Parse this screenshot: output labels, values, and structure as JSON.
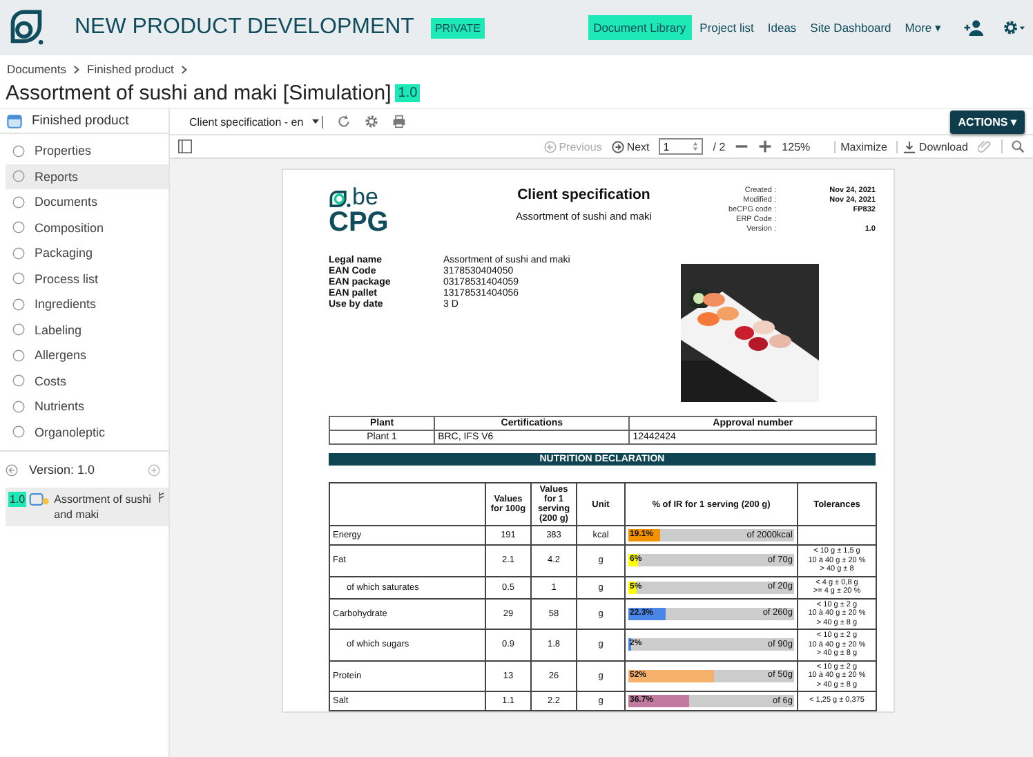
{
  "header": {
    "title": "NEW PRODUCT DEVELOPMENT",
    "badge": "PRIVATE",
    "nav": [
      {
        "label": "Document Library",
        "selected": true
      },
      {
        "label": "Project list",
        "selected": false
      },
      {
        "label": "Ideas",
        "selected": false
      },
      {
        "label": "Site Dashboard",
        "selected": false
      },
      {
        "label": "More ▾",
        "selected": false
      }
    ]
  },
  "breadcrumb": [
    "Documents",
    "Finished product"
  ],
  "page_title": "Assortment of sushi and maki [Simulation]",
  "version_badge": "1.0",
  "sidebar": {
    "header": "Finished product",
    "items": [
      {
        "label": "Properties",
        "selected": false
      },
      {
        "label": "Reports",
        "selected": true
      },
      {
        "label": "Documents",
        "selected": false
      },
      {
        "label": "Composition",
        "selected": false
      },
      {
        "label": "Packaging",
        "selected": false
      },
      {
        "label": "Process list",
        "selected": false
      },
      {
        "label": "Ingredients",
        "selected": false
      },
      {
        "label": "Labeling",
        "selected": false
      },
      {
        "label": "Allergens",
        "selected": false
      },
      {
        "label": "Costs",
        "selected": false
      },
      {
        "label": "Nutrients",
        "selected": false
      },
      {
        "label": "Organoleptic",
        "selected": false
      }
    ],
    "version_label": "Version: 1.0",
    "version_item": {
      "badge": "1.0",
      "label": "Assortment of sushi and maki"
    }
  },
  "toolbar": {
    "report": "Client specification - en",
    "actions": "ACTIONS ▾"
  },
  "viewer": {
    "previous": "Previous",
    "next": "Next",
    "page": "1",
    "pages": "/ 2",
    "zoom": "125%",
    "maximize": "Maximize",
    "download": "Download"
  },
  "document": {
    "logo_top": "be",
    "logo_bottom": "CPG",
    "title": "Client specification",
    "subtitle": "Assortment of sushi and maki",
    "meta": [
      {
        "label": "Created :",
        "value": "Nov 24, 2021"
      },
      {
        "label": "Modified :",
        "value": "Nov 24, 2021"
      },
      {
        "label": "beCPG code :",
        "value": "FP832"
      },
      {
        "label": "ERP Code :"
      },
      {
        "label": "Version :",
        "value": "1.0"
      }
    ],
    "fields": [
      {
        "label": "Legal name",
        "value": "Assortment of sushi and maki"
      },
      {
        "label": "EAN Code",
        "value": "3178530404050"
      },
      {
        "label": "EAN package",
        "value": "03178531404059"
      },
      {
        "label": "EAN pallet",
        "value": "13178531404056"
      },
      {
        "label": "Use by date",
        "value": "3 D"
      }
    ],
    "plant_table": {
      "columns": [
        "Plant",
        "Certifications",
        "Approval number"
      ],
      "rows": [
        [
          "Plant 1",
          "BRC, IFS V6",
          "12442424"
        ]
      ]
    },
    "nutrition_heading": "NUTRITION DECLARATION",
    "nutrition_columns": [
      "Values for 100g",
      "Values for 1 serving (200 g)",
      "Unit",
      "% of IR for 1 serving (200 g)",
      "Tolerances"
    ],
    "nutrients": [
      {
        "name": "Energy",
        "sub": false,
        "per100": "191",
        "serving": "383",
        "unit": "kcal",
        "percent": "19.1%",
        "of": "of 2000kcal",
        "level": 0.191,
        "color": "#f39200"
      },
      {
        "name": "Fat",
        "sub": false,
        "per100": "2.1",
        "serving": "4.2",
        "unit": "g",
        "percent": "6%",
        "of": "of 70g",
        "level": 0.06,
        "color": "#ffff00",
        "tolerances": [
          "< 10 g ± 1,5 g",
          "10 à 40 g ± 20 %",
          "> 40 g ± 8"
        ]
      },
      {
        "name": "of which saturates",
        "sub": true,
        "per100": "0.5",
        "serving": "1",
        "unit": "g",
        "percent": "5%",
        "of": "of 20g",
        "level": 0.05,
        "color": "#ffff00",
        "tolerances": [
          "< 4 g ± 0,8 g",
          ">= 4 g ± 20 %"
        ]
      },
      {
        "name": "Carbohydrate",
        "sub": false,
        "per100": "29",
        "serving": "58",
        "unit": "g",
        "percent": "22.3%",
        "of": "of 260g",
        "level": 0.223,
        "color": "#4a86e8",
        "tolerances": [
          "< 10 g ± 2 g",
          "10 à 40 g ± 20 %",
          "> 40 g ± 8 g"
        ]
      },
      {
        "name": "of which sugars",
        "sub": true,
        "per100": "0.9",
        "serving": "1.8",
        "unit": "g",
        "percent": "2%",
        "of": "of 90g",
        "level": 0.02,
        "color": "#4a86e8",
        "tolerances": [
          "< 10 g ± 2 g",
          "10 à 40 g ± 20 %",
          "> 40 g ± 8 g"
        ]
      },
      {
        "name": "Protein",
        "sub": false,
        "per100": "13",
        "serving": "26",
        "unit": "g",
        "percent": "52%",
        "of": "of 50g",
        "level": 0.52,
        "color": "#f6b26b",
        "tolerances": [
          "< 10 g ± 2 g",
          "10 à 40 g ± 20 %",
          "> 40 g ± 8 g"
        ]
      },
      {
        "name": "Salt",
        "sub": false,
        "per100": "1.1",
        "serving": "2.2",
        "unit": "g",
        "percent": "36.7%",
        "of": "of 6g",
        "level": 0.367,
        "color": "#c27ba0",
        "tolerances": [
          "< 1,25 g ± 0,375"
        ]
      }
    ]
  }
}
